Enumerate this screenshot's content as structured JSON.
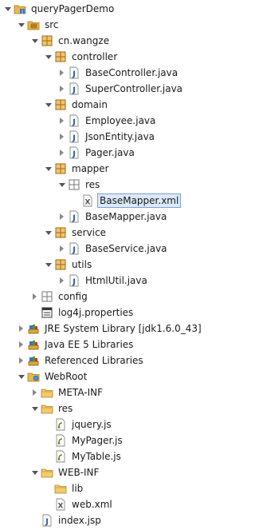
{
  "tree": [
    {
      "label": "queryPagerDemo",
      "icon": "java-project-icon",
      "depth": 0,
      "toggle": "open"
    },
    {
      "label": "src",
      "icon": "source-folder-icon",
      "depth": 1,
      "toggle": "open"
    },
    {
      "label": "cn.wangze",
      "icon": "package-icon",
      "depth": 2,
      "toggle": "open"
    },
    {
      "label": "controller",
      "icon": "package-icon",
      "depth": 3,
      "toggle": "open"
    },
    {
      "label": "BaseController.java",
      "icon": "java-file-icon",
      "depth": 4,
      "toggle": "closed"
    },
    {
      "label": "SuperController.java",
      "icon": "java-file-icon",
      "depth": 4,
      "toggle": "closed"
    },
    {
      "label": "domain",
      "icon": "package-icon",
      "depth": 3,
      "toggle": "open"
    },
    {
      "label": "Employee.java",
      "icon": "java-file-icon",
      "depth": 4,
      "toggle": "closed"
    },
    {
      "label": "JsonEntity.java",
      "icon": "java-file-icon",
      "depth": 4,
      "toggle": "closed"
    },
    {
      "label": "Pager.java",
      "icon": "java-file-icon",
      "depth": 4,
      "toggle": "closed"
    },
    {
      "label": "mapper",
      "icon": "package-icon",
      "depth": 3,
      "toggle": "open"
    },
    {
      "label": "res",
      "icon": "package-empty-icon",
      "depth": 4,
      "toggle": "open"
    },
    {
      "label": "BaseMapper.xml",
      "icon": "xml-file-icon",
      "depth": 5,
      "toggle": "none",
      "selected": true
    },
    {
      "label": "BaseMapper.java",
      "icon": "java-file-icon",
      "depth": 4,
      "toggle": "closed"
    },
    {
      "label": "service",
      "icon": "package-icon",
      "depth": 3,
      "toggle": "open"
    },
    {
      "label": "BaseService.java",
      "icon": "java-file-icon",
      "depth": 4,
      "toggle": "closed"
    },
    {
      "label": "utils",
      "icon": "package-icon",
      "depth": 3,
      "toggle": "open"
    },
    {
      "label": "HtmlUtil.java",
      "icon": "java-file-icon",
      "depth": 4,
      "toggle": "closed"
    },
    {
      "label": "config",
      "icon": "package-empty-icon",
      "depth": 2,
      "toggle": "closed"
    },
    {
      "label": "log4j.properties",
      "icon": "properties-file-icon",
      "depth": 2,
      "toggle": "none"
    },
    {
      "label": "JRE System Library [jdk1.6.0_43]",
      "icon": "library-icon",
      "depth": 1,
      "toggle": "closed"
    },
    {
      "label": "Java EE 5 Libraries",
      "icon": "library-icon",
      "depth": 1,
      "toggle": "closed"
    },
    {
      "label": "Referenced Libraries",
      "icon": "library-icon",
      "depth": 1,
      "toggle": "closed"
    },
    {
      "label": "WebRoot",
      "icon": "web-folder-icon",
      "depth": 1,
      "toggle": "open"
    },
    {
      "label": "META-INF",
      "icon": "folder-icon",
      "depth": 2,
      "toggle": "closed"
    },
    {
      "label": "res",
      "icon": "folder-icon",
      "depth": 2,
      "toggle": "open"
    },
    {
      "label": "jquery.js",
      "icon": "js-file-icon",
      "depth": 3,
      "toggle": "none"
    },
    {
      "label": "MyPager.js",
      "icon": "js-file-icon",
      "depth": 3,
      "toggle": "none"
    },
    {
      "label": "MyTable.js",
      "icon": "js-file-icon",
      "depth": 3,
      "toggle": "none"
    },
    {
      "label": "WEB-INF",
      "icon": "folder-icon",
      "depth": 2,
      "toggle": "open"
    },
    {
      "label": "lib",
      "icon": "folder-icon",
      "depth": 3,
      "toggle": "none"
    },
    {
      "label": "web.xml",
      "icon": "xml-file-icon",
      "depth": 3,
      "toggle": "none"
    },
    {
      "label": "index.jsp",
      "icon": "jsp-file-icon",
      "depth": 2,
      "toggle": "none"
    }
  ],
  "colors": {
    "selection_bg": "#dbe9fb",
    "selection_border": "#7da2ce",
    "folder": "#e8b94a",
    "package": "#c98a2b",
    "java_letter": "#2a5db0"
  }
}
